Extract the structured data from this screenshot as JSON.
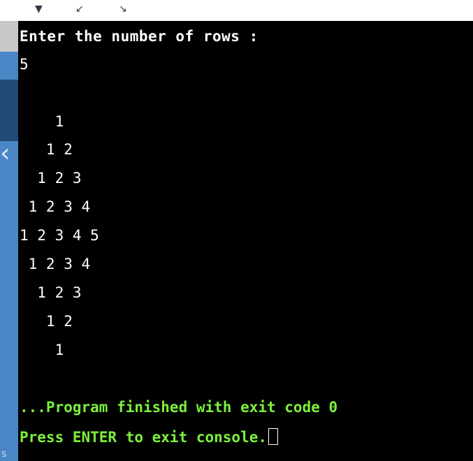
{
  "toolbar": {
    "icons": [
      "chevron-down-icon",
      "resize-arrow-icon",
      "export-arrow-icon"
    ],
    "glyphs": [
      "▼",
      "↙",
      "↘"
    ]
  },
  "sidebar": {
    "collapse_glyph": "‹",
    "partial_letter": "s"
  },
  "console": {
    "prompt": "Enter the number of rows :",
    "input_value": "5",
    "pattern_rows": [
      "    1",
      "   1 2",
      "  1 2 3",
      " 1 2 3 4",
      "1 2 3 4 5",
      " 1 2 3 4",
      "  1 2 3",
      "   1 2",
      "    1"
    ],
    "exit_message": "...Program finished with exit code 0",
    "press_enter_message": "Press ENTER to exit console."
  },
  "colors": {
    "console_bg": "#000000",
    "console_text": "#ffffff",
    "status_green": "#7bf13a",
    "sidebar_blue": "#4a86c5"
  }
}
